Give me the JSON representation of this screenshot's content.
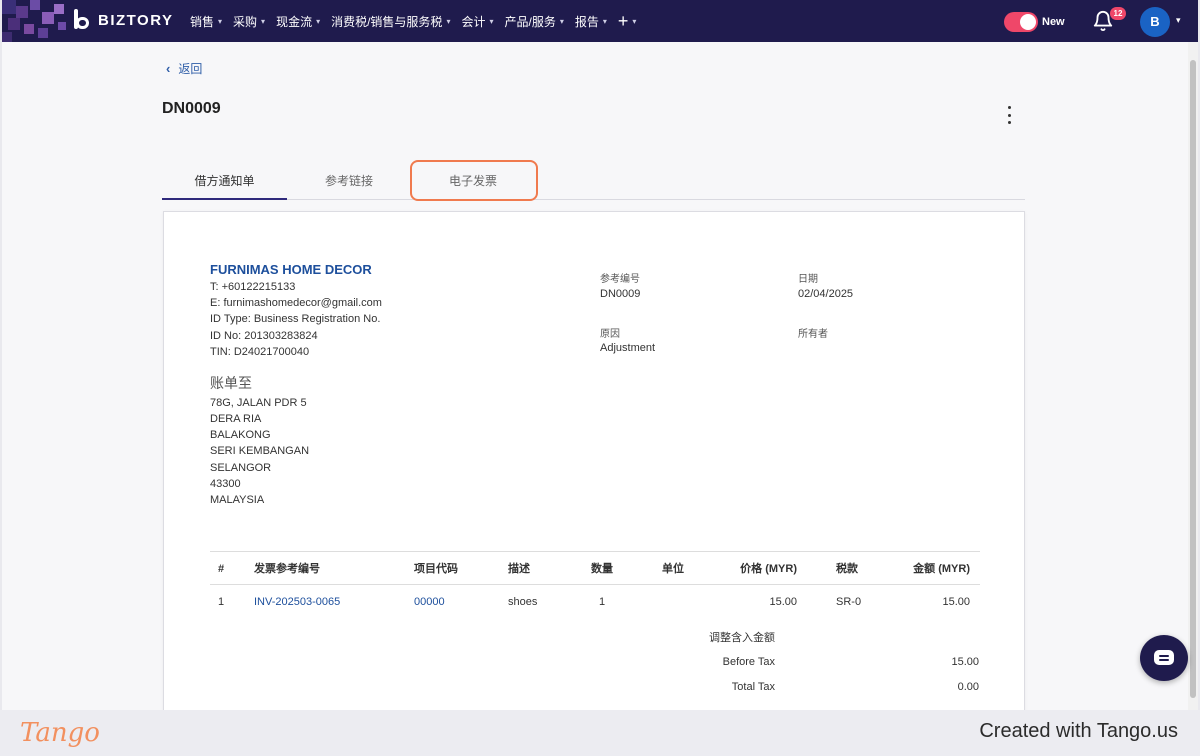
{
  "nav": {
    "brand": "BIZTORY",
    "menu": [
      "销售",
      "采购",
      "现金流",
      "消费税/销售与服务税",
      "会计",
      "产品/服务",
      "报告"
    ],
    "plus": "+",
    "toggle_label": "New",
    "notification_count": "12",
    "avatar_initial": "B"
  },
  "page": {
    "back_label": "返回",
    "doc_number": "DN0009",
    "tabs": [
      "借方通知单",
      "参考链接",
      "电子发票"
    ],
    "active_tab": "借方通知单"
  },
  "company": {
    "name": "FURNIMAS HOME DECOR",
    "phone": "T: +60122215133",
    "email": "E: furnimashomedecor@gmail.com",
    "id_type": "ID Type: Business Registration No.",
    "id_no": "ID No: 201303283824",
    "tin": "TIN: D24021700040"
  },
  "bill_to": {
    "label": "账单至",
    "lines": [
      "78G, JALAN PDR 5",
      "DERA RIA",
      "BALAKONG",
      "SERI KEMBANGAN",
      "SELANGOR",
      "43300",
      "MALAYSIA"
    ]
  },
  "meta": {
    "ref_label": "参考编号",
    "ref_value": "DN0009",
    "date_label": "日期",
    "date_value": "02/04/2025",
    "reason_label": "原因",
    "reason_value": "Adjustment",
    "owner_label": "所有者"
  },
  "table": {
    "headers": [
      "#",
      "发票参考编号",
      "项目代码",
      "描述",
      "数量",
      "单位",
      "价格 (MYR)",
      "税款",
      "金额 (MYR)"
    ],
    "rows": [
      [
        "1",
        "INV-202503-0065",
        "00000",
        "shoes",
        "1",
        "",
        "15.00",
        "SR-0",
        "15.00"
      ]
    ]
  },
  "summary": {
    "title": "调整含入金额",
    "before_tax_label": "Before Tax",
    "before_tax_value": "15.00",
    "total_tax_label": "Total Tax",
    "total_tax_value": "0.00"
  },
  "footer": {
    "brand": "Tango",
    "created": "Created with Tango.us"
  },
  "colors": {
    "nav_bg": "#1f1b4d",
    "accent_blue": "#1d4f9c",
    "toggle_pink": "#ef4769",
    "highlight_orange": "#f07a4e"
  }
}
